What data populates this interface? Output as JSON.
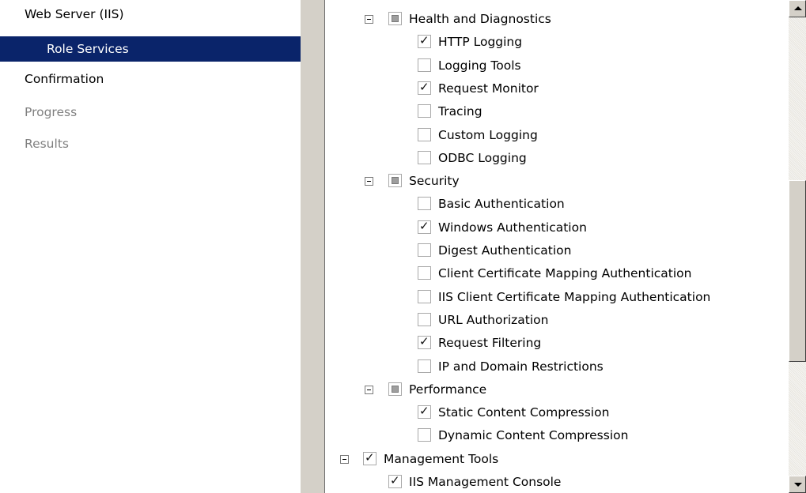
{
  "wizard_steps": [
    {
      "label": "Web Server (IIS)",
      "state": "normal"
    },
    {
      "label": "Role Services",
      "state": "selected"
    },
    {
      "label": "Confirmation",
      "state": "normal"
    },
    {
      "label": "Progress",
      "state": "disabled"
    },
    {
      "label": "Results",
      "state": "disabled"
    }
  ],
  "tree": [
    {
      "label": "Health and Diagnostics",
      "level": 1,
      "state": "partial",
      "expander": true
    },
    {
      "label": "HTTP Logging",
      "level": 2,
      "state": "checked"
    },
    {
      "label": "Logging Tools",
      "level": 2,
      "state": "unchecked"
    },
    {
      "label": "Request Monitor",
      "level": 2,
      "state": "checked"
    },
    {
      "label": "Tracing",
      "level": 2,
      "state": "unchecked"
    },
    {
      "label": "Custom Logging",
      "level": 2,
      "state": "unchecked"
    },
    {
      "label": "ODBC Logging",
      "level": 2,
      "state": "unchecked"
    },
    {
      "label": "Security",
      "level": 1,
      "state": "partial",
      "expander": true
    },
    {
      "label": "Basic Authentication",
      "level": 2,
      "state": "unchecked"
    },
    {
      "label": "Windows Authentication",
      "level": 2,
      "state": "checked"
    },
    {
      "label": "Digest Authentication",
      "level": 2,
      "state": "unchecked"
    },
    {
      "label": "Client Certificate Mapping Authentication",
      "level": 2,
      "state": "unchecked"
    },
    {
      "label": "IIS Client Certificate Mapping Authentication",
      "level": 2,
      "state": "unchecked"
    },
    {
      "label": "URL Authorization",
      "level": 2,
      "state": "unchecked"
    },
    {
      "label": "Request Filtering",
      "level": 2,
      "state": "checked"
    },
    {
      "label": "IP and Domain Restrictions",
      "level": 2,
      "state": "unchecked"
    },
    {
      "label": "Performance",
      "level": 1,
      "state": "partial",
      "expander": true
    },
    {
      "label": "Static Content Compression",
      "level": 2,
      "state": "checked"
    },
    {
      "label": "Dynamic Content Compression",
      "level": 2,
      "state": "unchecked"
    },
    {
      "label": "Management Tools",
      "level": 0,
      "state": "checked",
      "expander": true
    },
    {
      "label": "IIS Management Console",
      "level": 1,
      "state": "checked"
    }
  ],
  "icons": {
    "expander": "collapse-minus-icon",
    "scroll_up": "scroll-up-arrow-icon",
    "scroll_down": "scroll-down-arrow-icon"
  }
}
